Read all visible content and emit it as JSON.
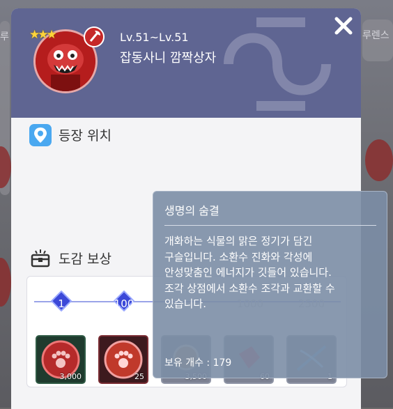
{
  "monster": {
    "level_range": "Lv.51~Lv.51",
    "name": "잡동사니 깜짝상자",
    "stars": 3,
    "rank_stars": "★★★"
  },
  "background": {
    "left_tab_partial": "루",
    "right_tab_partial": "루렌스"
  },
  "sections": {
    "location_title": "등장 위치",
    "reward_title": "도감 보상"
  },
  "reward_track": {
    "milestones": [
      "1",
      "100",
      "1000",
      "2500"
    ],
    "slots": [
      {
        "item": "paw-token",
        "qty": "3,000"
      },
      {
        "item": "paw-token-red",
        "qty": "25"
      },
      {
        "item": "coin",
        "qty": "3,500"
      },
      {
        "item": "red-item",
        "qty": "60"
      },
      {
        "item": "blue-bow",
        "qty": "1"
      }
    ]
  },
  "tooltip": {
    "title": "생명의 숨결",
    "description_lines": [
      "개화하는 식물의 맑은 정기가 담긴",
      "구슬입니다. 소환수 진화와 각성에",
      "안성맞춤인 에너지가 깃들어 있습니다.",
      "조각 상점에서 소환수 조각과 교환할 수",
      "있습니다."
    ],
    "owned_label": "보유 개수 : 179"
  },
  "colors": {
    "header_bg": "#5f6592",
    "tooltip_bg": "#7c8ea6",
    "accent_blue": "#4aa8f0"
  }
}
